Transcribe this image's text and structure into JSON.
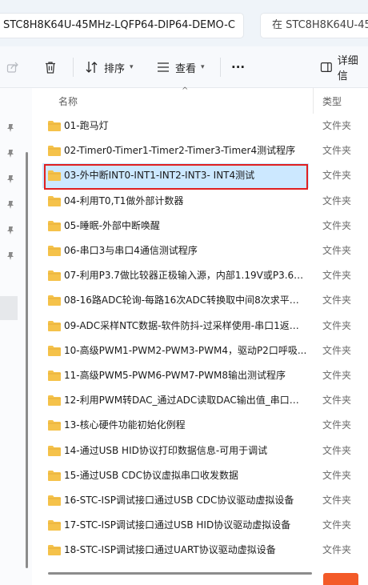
{
  "address_bar": {
    "path": "STC8H8K64U-45MHz-LQFP64-DIP64-DEMO-C",
    "search_placeholder": "在 STC8H8K64U-45"
  },
  "toolbar": {
    "sort_label": "排序",
    "view_label": "查看",
    "more_label": "···",
    "details_label": "详细信"
  },
  "columns": {
    "name": "名称",
    "type": "类型"
  },
  "files": [
    {
      "name": "01-跑马灯",
      "type": "文件夹"
    },
    {
      "name": "02-Timer0-Timer1-Timer2-Timer3-Timer4测试程序",
      "type": "文件夹"
    },
    {
      "name": "03-外中断INT0-INT1-INT2-INT3- INT4测试",
      "type": "文件夹",
      "selected": true
    },
    {
      "name": "04-利用T0,T1做外部计数器",
      "type": "文件夹"
    },
    {
      "name": "05-睡眠-外部中断唤醒",
      "type": "文件夹"
    },
    {
      "name": "06-串口3与串口4通信测试程序",
      "type": "文件夹"
    },
    {
      "name": "07-利用P3.7做比较器正极输入源，内部1.19V或P3.6口...",
      "type": "文件夹"
    },
    {
      "name": "08-16路ADC轮询-每路16次ADC转换取中间8次求平均...",
      "type": "文件夹"
    },
    {
      "name": "09-ADC采样NTC数据-软件防抖-过采样使用-串口1返回...",
      "type": "文件夹"
    },
    {
      "name": "10-高级PWM1-PWM2-PWM3-PWM4，驱动P2口呼吸...",
      "type": "文件夹"
    },
    {
      "name": "11-高级PWM5-PWM6-PWM7-PWM8输出测试程序",
      "type": "文件夹"
    },
    {
      "name": "12-利用PWM转DAC_通过ADC读取DAC输出值_串口设...",
      "type": "文件夹"
    },
    {
      "name": "13-核心硬件功能初始化例程",
      "type": "文件夹"
    },
    {
      "name": "14-通过USB HID协议打印数据信息-可用于调试",
      "type": "文件夹"
    },
    {
      "name": "15-通过USB CDC协议虚拟串口收发数据",
      "type": "文件夹"
    },
    {
      "name": "16-STC-ISP调试接口通过USB CDC协议驱动虚拟设备",
      "type": "文件夹"
    },
    {
      "name": "17-STC-ISP调试接口通过USB HID协议驱动虚拟设备",
      "type": "文件夹"
    },
    {
      "name": "18-STC-ISP调试接口通过UART协议驱动虚拟设备",
      "type": "文件夹"
    }
  ],
  "colors": {
    "folder": "#f5c24a",
    "selection": "#cce8ff",
    "highlight_border": "#e02020"
  }
}
